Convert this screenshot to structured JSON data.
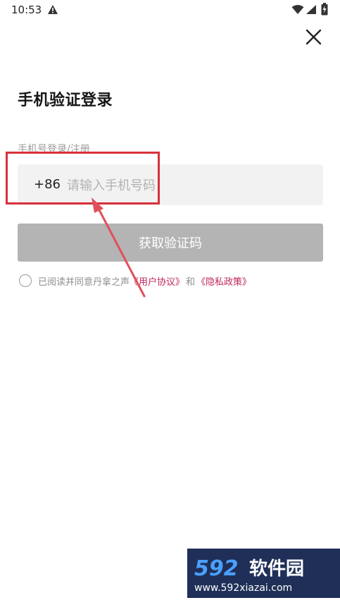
{
  "status_bar": {
    "time": "10:53"
  },
  "title": "手机验证登录",
  "field_label": "手机号登录/注册",
  "phone": {
    "country_code": "+86",
    "placeholder": "请输入手机号码",
    "value": ""
  },
  "get_code_button": "获取验证码",
  "agreement": {
    "prefix": "已阅读并同意丹拿之声",
    "user_agreement": "《用户协议》",
    "conjunction": "和",
    "privacy_policy": "《隐私政策》",
    "checked": false
  },
  "watermark": {
    "brand": "592软件园",
    "url": "www.592xiazai.com"
  },
  "colors": {
    "accent_link": "#c0265a",
    "annotation_red": "#d8313a",
    "button_disabled": "#b4b4b4"
  }
}
